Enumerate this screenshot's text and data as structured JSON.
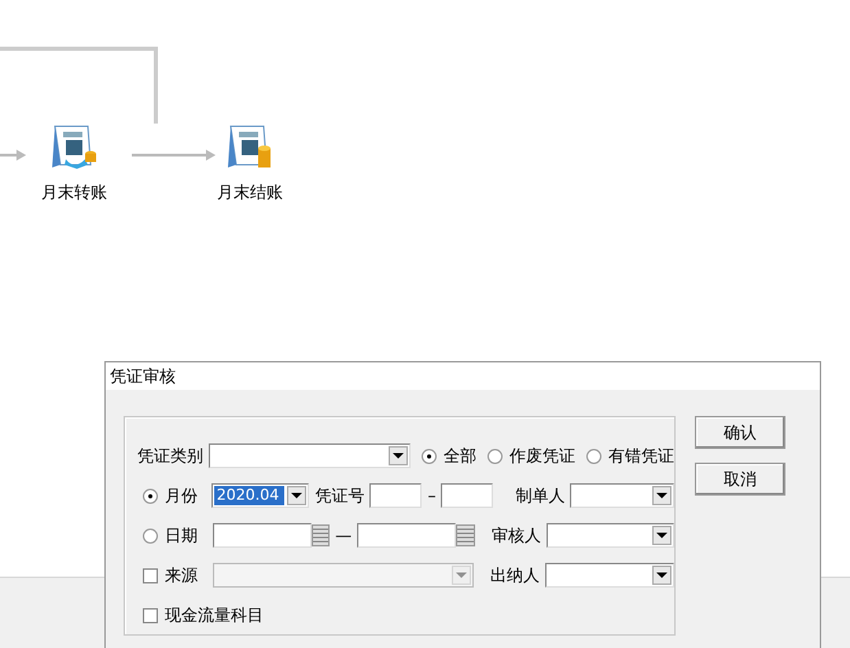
{
  "flow_nodes": [
    {
      "label": "月末转账",
      "kind": "transfer"
    },
    {
      "label": "月末结账",
      "kind": "close"
    }
  ],
  "dialog": {
    "title": "凭证审核",
    "voucher_type": {
      "label": "凭证类别"
    },
    "scope_options": [
      {
        "label": "全部",
        "selected": true
      },
      {
        "label": "作废凭证",
        "selected": false
      },
      {
        "label": "有错凭证",
        "selected": false
      }
    ],
    "month": {
      "label": "月份",
      "selected": true,
      "value": "2020.04"
    },
    "date": {
      "label": "日期",
      "selected": false,
      "separator": "—"
    },
    "voucher_no": {
      "label": "凭证号",
      "separator": "–"
    },
    "preparer": {
      "label": "制单人"
    },
    "reviewer": {
      "label": "审核人"
    },
    "cashier": {
      "label": "出纳人"
    },
    "source": {
      "label": "来源",
      "checked": false
    },
    "cash_flow": {
      "label": "现金流量科目",
      "checked": false
    },
    "buttons": [
      "确认",
      "取消"
    ]
  }
}
